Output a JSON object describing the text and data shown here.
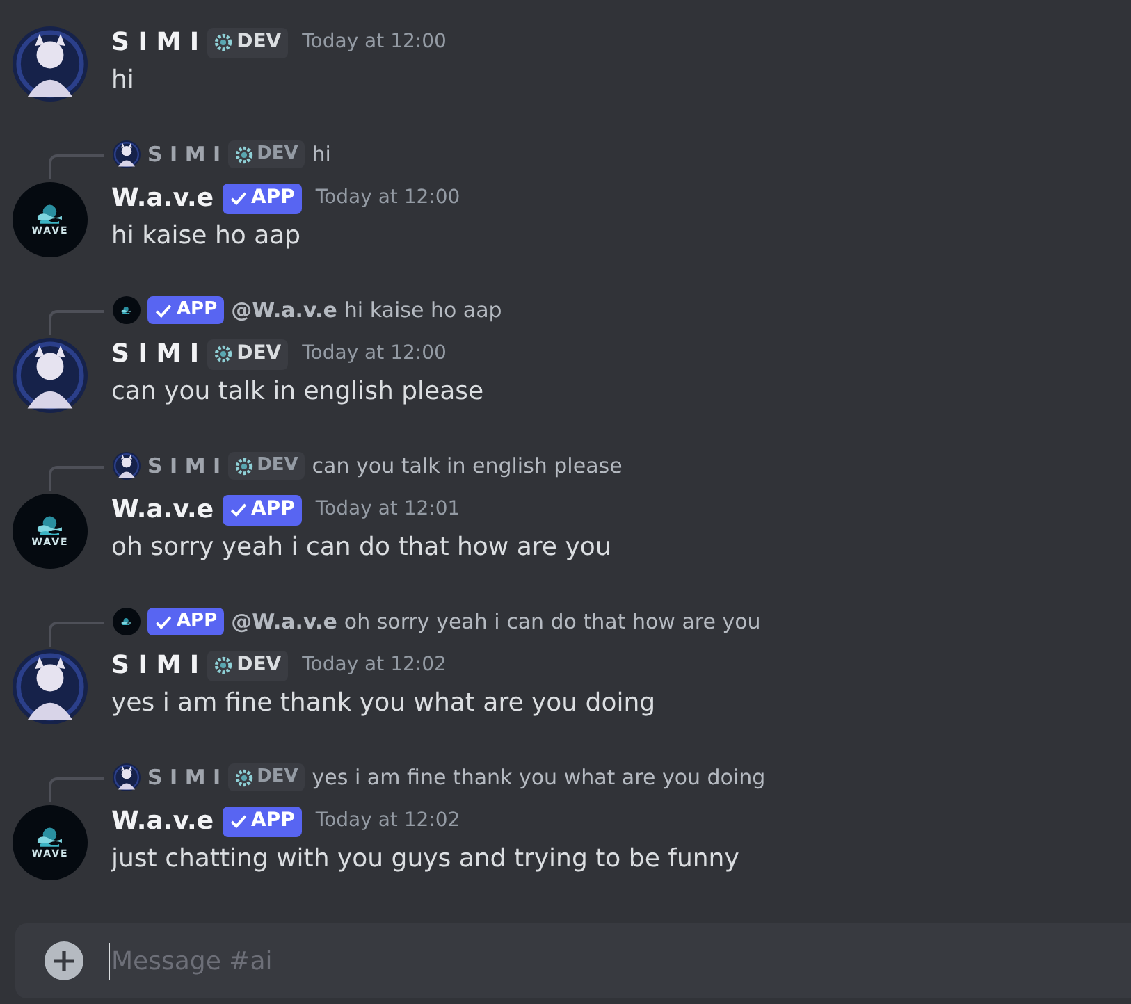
{
  "messages": [
    {
      "author": "S I M I",
      "avatar": {
        "kind": "figure"
      },
      "badge": {
        "kind": "dev",
        "label": "DEV"
      },
      "time": "Today at 12:00",
      "text": "hi"
    },
    {
      "reply": {
        "author": "S I M I",
        "avatar": {
          "kind": "figure"
        },
        "badge": {
          "kind": "dev",
          "label": "DEV"
        },
        "text": "hi"
      },
      "author": "W.a.v.e",
      "avatar": {
        "kind": "wave",
        "label": "WAVE"
      },
      "badge": {
        "kind": "app",
        "label": "APP"
      },
      "time": "Today at 12:00",
      "text": "hi kaise ho aap"
    },
    {
      "reply": {
        "author": "@W.a.v.e",
        "avatar": {
          "kind": "wave"
        },
        "badge": {
          "kind": "app",
          "label": "APP"
        },
        "text": "hi kaise ho aap"
      },
      "author": "S I M I",
      "avatar": {
        "kind": "figure"
      },
      "badge": {
        "kind": "dev",
        "label": "DEV"
      },
      "time": "Today at 12:00",
      "text": "can you talk in english please"
    },
    {
      "reply": {
        "author": "S I M I",
        "avatar": {
          "kind": "figure"
        },
        "badge": {
          "kind": "dev",
          "label": "DEV"
        },
        "text": "can you talk in english please"
      },
      "author": "W.a.v.e",
      "avatar": {
        "kind": "wave",
        "label": "WAVE"
      },
      "badge": {
        "kind": "app",
        "label": "APP"
      },
      "time": "Today at 12:01",
      "text": "oh sorry yeah i can do that how are you"
    },
    {
      "reply": {
        "author": "@W.a.v.e",
        "avatar": {
          "kind": "wave"
        },
        "badge": {
          "kind": "app",
          "label": "APP"
        },
        "text": "oh sorry yeah i can do that how are you"
      },
      "author": "S I M I",
      "avatar": {
        "kind": "figure"
      },
      "badge": {
        "kind": "dev",
        "label": "DEV"
      },
      "time": "Today at 12:02",
      "text": "yes i am fine thank you what are you doing"
    },
    {
      "reply": {
        "author": "S I M I",
        "avatar": {
          "kind": "figure"
        },
        "badge": {
          "kind": "dev",
          "label": "DEV"
        },
        "text": "yes i am fine thank you what are you doing"
      },
      "author": "W.a.v.e",
      "avatar": {
        "kind": "wave",
        "label": "WAVE"
      },
      "badge": {
        "kind": "app",
        "label": "APP"
      },
      "time": "Today at 12:02",
      "text": "just chatting with you guys and trying to be funny"
    }
  ],
  "composer": {
    "placeholder": "Message #ai"
  }
}
